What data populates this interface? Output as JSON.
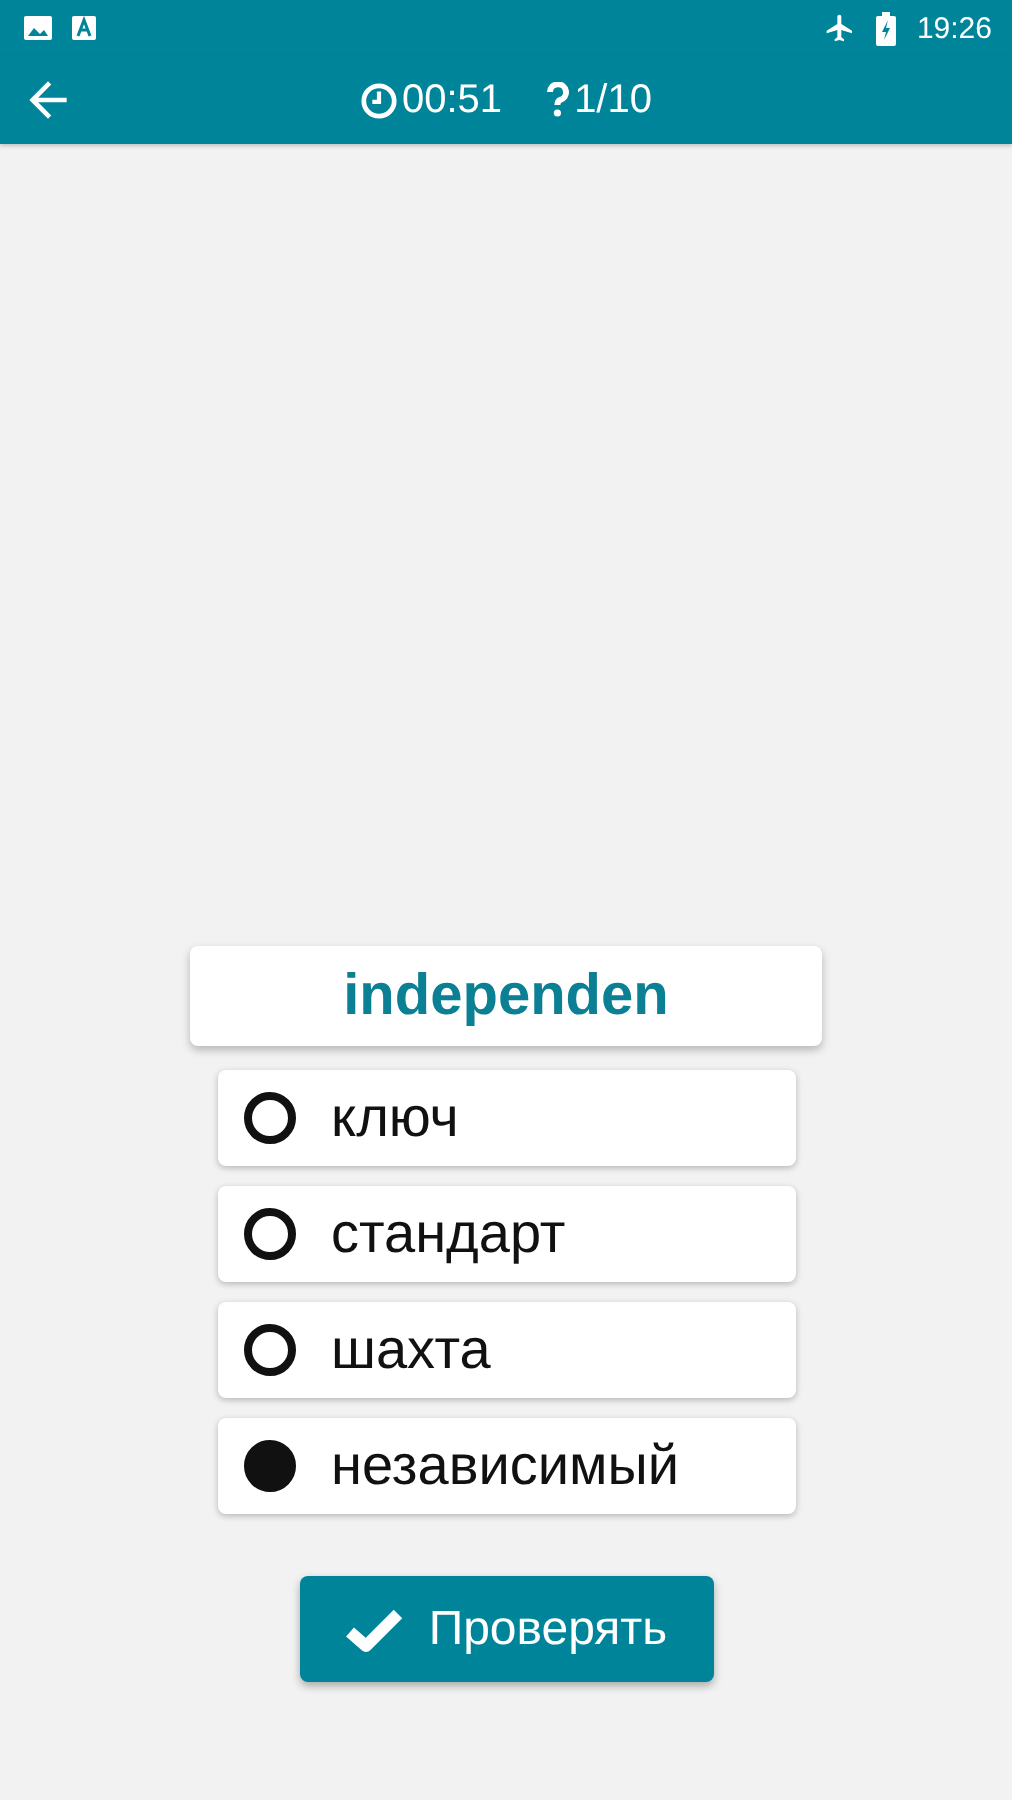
{
  "status_bar": {
    "time": "19:26"
  },
  "toolbar": {
    "timer": "00:51",
    "progress": "1/10"
  },
  "word": "independen",
  "options": [
    {
      "label": "ключ",
      "selected": false
    },
    {
      "label": "стандарт",
      "selected": false
    },
    {
      "label": "шахта",
      "selected": false
    },
    {
      "label": "независимый",
      "selected": true
    }
  ],
  "check_button": "Проверять"
}
